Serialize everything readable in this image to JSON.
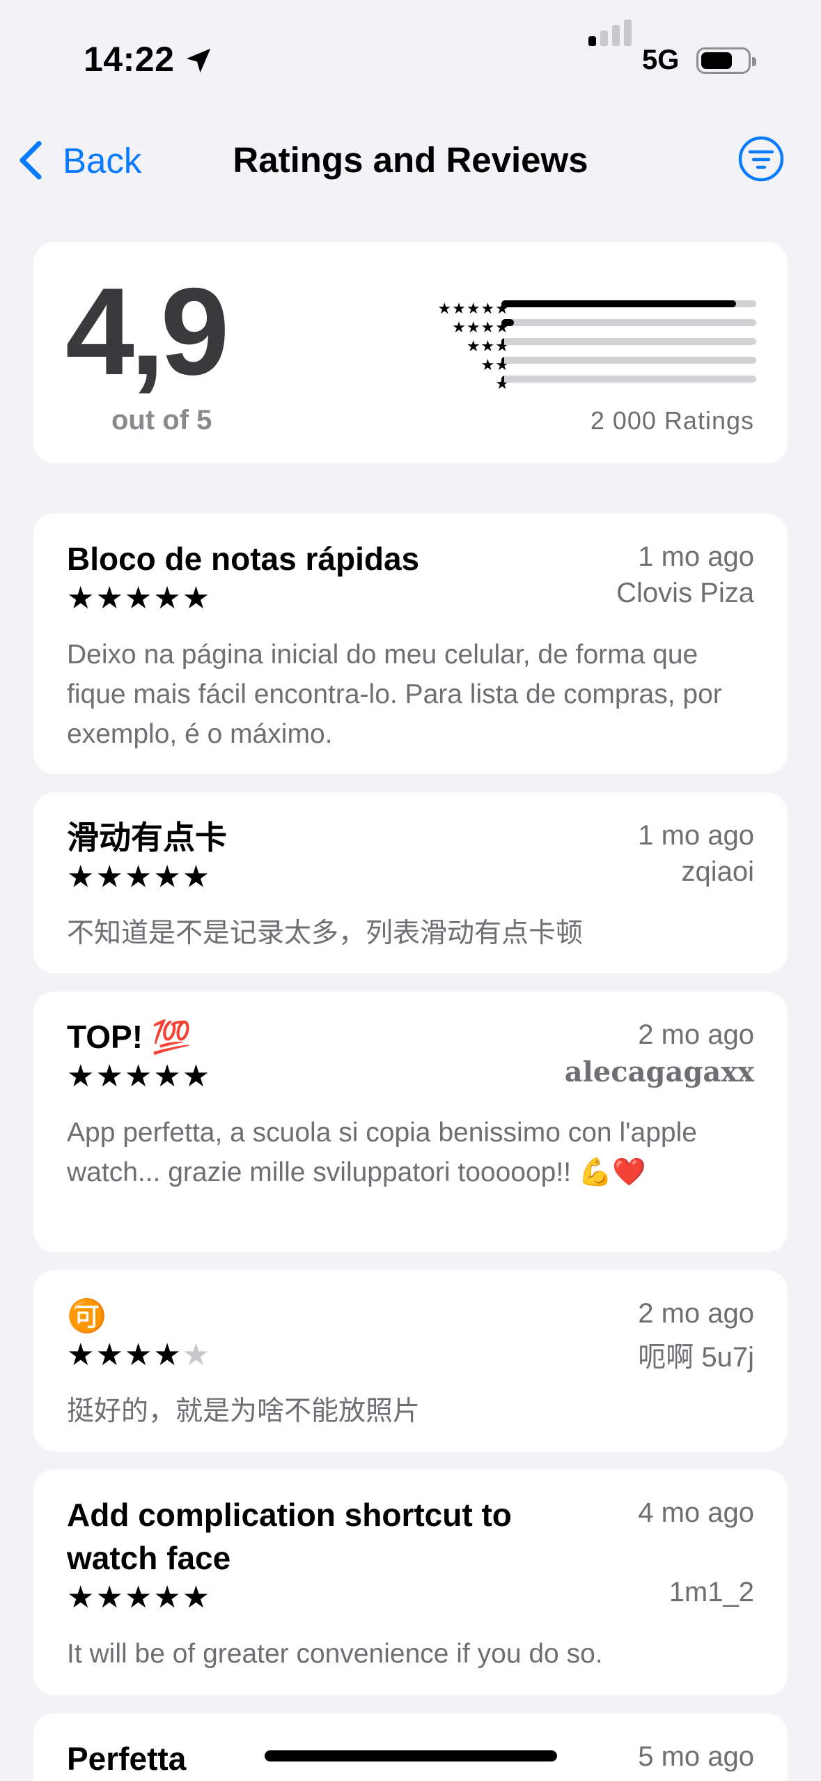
{
  "status_bar": {
    "time": "14:22",
    "location_icon": "location-arrow-icon",
    "network": "5G",
    "signal_bars_active": 1,
    "battery_icon": "battery-icon"
  },
  "nav": {
    "back_label": "Back",
    "title": "Ratings and Reviews",
    "filter_icon": "filter-circle-icon",
    "accent_color": "#0A7AFF"
  },
  "summary": {
    "average": "4,9",
    "out_of": "out of 5",
    "count_label": "2 000 Ratings",
    "distribution": [
      {
        "stars": 5,
        "label": "★★★★★",
        "fraction": 0.92
      },
      {
        "stars": 4,
        "label": "★★★★",
        "fraction": 0.05
      },
      {
        "stars": 3,
        "label": "★★★",
        "fraction": 0.01
      },
      {
        "stars": 2,
        "label": "★★",
        "fraction": 0.01
      },
      {
        "stars": 1,
        "label": "★",
        "fraction": 0.01
      }
    ]
  },
  "reviews": [
    {
      "title": "Bloco de notas rápidas",
      "date": "1 mo ago",
      "author": "Clovis Piza",
      "rating": 5,
      "stars": "★★★★★",
      "stars_off": "",
      "body": "Deixo na página inicial do meu celular, de forma que fique mais fácil encontra-lo. Para lista de compras, por exemplo, é o máximo."
    },
    {
      "title": "滑动有点卡",
      "date": "1 mo ago",
      "author": "zqiaoi",
      "rating": 5,
      "stars": "★★★★★",
      "stars_off": "",
      "body": "不知道是不是记录太多，列表滑动有点卡顿"
    },
    {
      "title": "TOP! 💯",
      "date": "2 mo ago",
      "author": "alecagagaxx",
      "rating": 5,
      "stars": "★★★★★",
      "stars_off": "",
      "body": "App perfetta, a scuola si copia benissimo con l'apple watch... grazie mille sviluppatori tooooop!! 💪❤️"
    },
    {
      "title": "🉑",
      "date": "2 mo ago",
      "author": "呃啊 5u7j",
      "rating": 4,
      "stars": "★★★★",
      "stars_off": "★",
      "body": "挺好的，就是为啥不能放照片"
    },
    {
      "title": "Add complication shortcut to watch face",
      "date": "4 mo ago",
      "author": "1m1_2",
      "rating": 5,
      "stars": "★★★★★",
      "stars_off": "",
      "body": "It will be of greater convenience if you do so."
    },
    {
      "title": "Perfetta",
      "date": "5 mo ago",
      "author": "",
      "rating": null,
      "stars": "",
      "stars_off": "",
      "body": ""
    }
  ]
}
